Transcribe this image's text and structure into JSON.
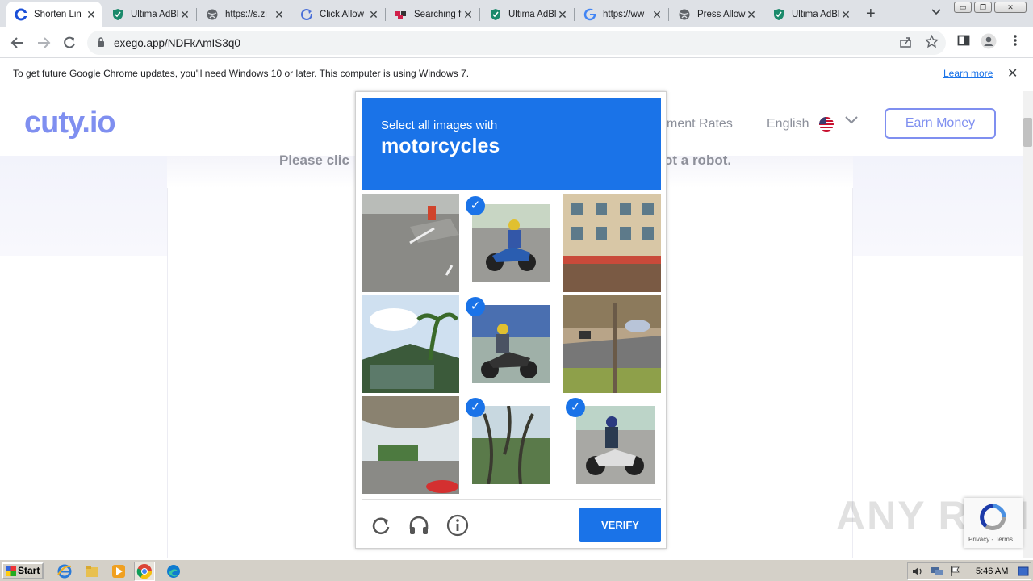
{
  "browser": {
    "tabs": [
      {
        "title": "Shorten Lin",
        "icon": "cuty-icon",
        "active": true
      },
      {
        "title": "Ultima AdBl",
        "icon": "shield-icon",
        "active": false
      },
      {
        "title": "https://s.zi",
        "icon": "globe-icon",
        "active": false
      },
      {
        "title": "Click Allow",
        "icon": "refresh-icon",
        "active": false
      },
      {
        "title": "Searching f",
        "icon": "dots-icon",
        "active": false
      },
      {
        "title": "Ultima AdBl",
        "icon": "shield-icon",
        "active": false
      },
      {
        "title": "https://ww",
        "icon": "google-icon",
        "active": false
      },
      {
        "title": "Press Allow",
        "icon": "globe-icon",
        "active": false
      },
      {
        "title": "Ultima AdBl",
        "icon": "shield-icon",
        "active": false
      }
    ],
    "new_tab": "+",
    "url": "exego.app/NDFkAmIS3q0"
  },
  "infobar": {
    "message": "To get future Google Chrome updates, you'll need Windows 10 or later. This computer is using Windows 7.",
    "learn_more": "Learn more"
  },
  "site": {
    "logo": "cuty.io",
    "nav_payment": "yment Rates",
    "language": "English",
    "earn_button": "Earn Money",
    "robot_left": "Please clic",
    "robot_right": "ot a robot."
  },
  "captcha": {
    "prompt": "Select all images with",
    "object": "motorcycles",
    "tiles": [
      {
        "scene": "road",
        "selected": false
      },
      {
        "scene": "motorcycle",
        "selected": true
      },
      {
        "scene": "shops",
        "selected": false
      },
      {
        "scene": "palm",
        "selected": false
      },
      {
        "scene": "motorcycle",
        "selected": true
      },
      {
        "scene": "street",
        "selected": false
      },
      {
        "scene": "overpass",
        "selected": false
      },
      {
        "scene": "trees",
        "selected": true
      },
      {
        "scene": "motorcycle",
        "selected": true
      }
    ],
    "verify": "VERIFY"
  },
  "watermark": {
    "text": "ANY RUN",
    "recaptcha_terms": "Privacy - Terms"
  },
  "taskbar": {
    "start": "Start",
    "clock": "5:46 AM"
  },
  "colors": {
    "accent": "#1a73e8",
    "brand": "#7f8ff0"
  }
}
